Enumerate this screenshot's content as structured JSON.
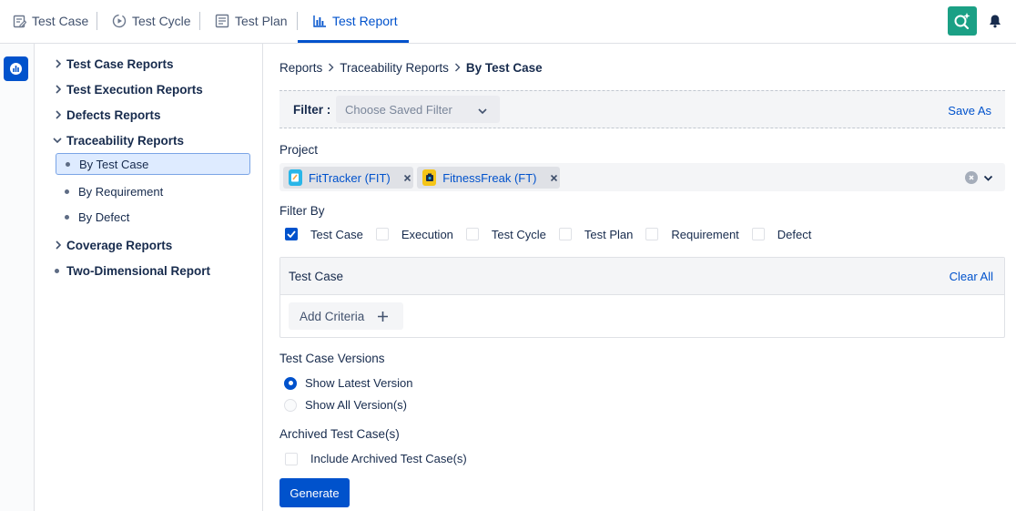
{
  "nav": {
    "tabs": [
      {
        "label": "Test Case",
        "icon": "test-case-icon"
      },
      {
        "label": "Test Cycle",
        "icon": "test-cycle-icon"
      },
      {
        "label": "Test Plan",
        "icon": "test-plan-icon"
      },
      {
        "label": "Test Report",
        "icon": "report-chart-icon",
        "active": true
      }
    ],
    "accent": "#0052cc",
    "app_icon_color": "#1ba085"
  },
  "sidebar": {
    "items": [
      {
        "label": "Test Case Reports",
        "expanded": false
      },
      {
        "label": "Test Execution Reports",
        "expanded": false
      },
      {
        "label": "Defects Reports",
        "expanded": false
      },
      {
        "label": "Traceability Reports",
        "expanded": true,
        "children": [
          {
            "label": "By Test Case",
            "selected": true
          },
          {
            "label": "By Requirement"
          },
          {
            "label": "By Defect"
          }
        ]
      },
      {
        "label": "Coverage Reports",
        "expanded": false
      },
      {
        "label": "Two-Dimensional Report",
        "leaf": true
      }
    ]
  },
  "breadcrumb": [
    "Reports",
    "Traceability Reports",
    "By Test Case"
  ],
  "filter": {
    "label": "Filter :",
    "placeholder": "Choose Saved Filter",
    "save_as": "Save As"
  },
  "project": {
    "label": "Project",
    "chips": [
      {
        "label": "FitTracker (FIT)"
      },
      {
        "label": "FitnessFreak (FT)"
      }
    ]
  },
  "filter_by": {
    "label": "Filter By",
    "options": [
      {
        "label": "Test Case",
        "checked": true
      },
      {
        "label": "Execution",
        "checked": false
      },
      {
        "label": "Test Cycle",
        "checked": false
      },
      {
        "label": "Test Plan",
        "checked": false
      },
      {
        "label": "Requirement",
        "checked": false
      },
      {
        "label": "Defect",
        "checked": false
      }
    ]
  },
  "criteria": {
    "title": "Test Case",
    "clear_all": "Clear All",
    "add": "Add Criteria"
  },
  "versions": {
    "label": "Test Case Versions",
    "options": [
      {
        "label": "Show Latest Version",
        "selected": true
      },
      {
        "label": "Show All Version(s)",
        "selected": false
      }
    ]
  },
  "archived": {
    "label": "Archived Test Case(s)",
    "option": "Include Archived Test Case(s)",
    "checked": false
  },
  "generate": "Generate"
}
